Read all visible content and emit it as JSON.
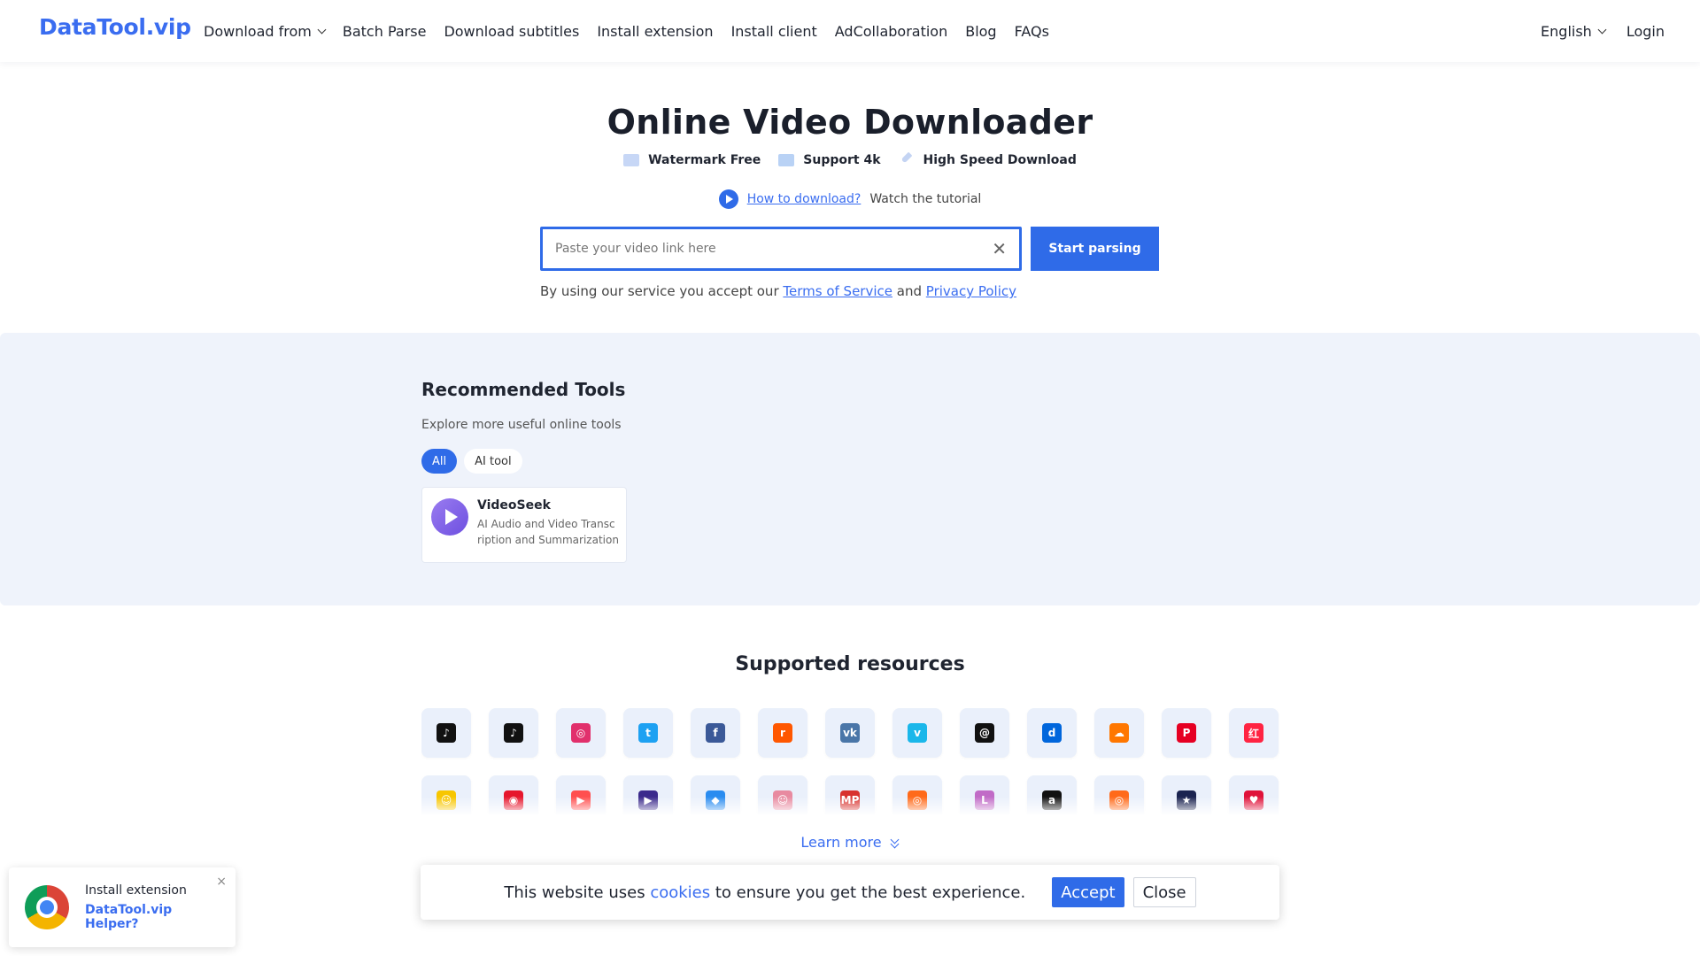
{
  "header": {
    "logo": "DataTool.vip",
    "nav": [
      {
        "label": "Download from",
        "dropdown": true
      },
      {
        "label": "Batch Parse"
      },
      {
        "label": "Download subtitles"
      },
      {
        "label": "Install extension"
      },
      {
        "label": "Install client"
      },
      {
        "label": "AdCollaboration"
      },
      {
        "label": "Blog"
      },
      {
        "label": "FAQs"
      }
    ],
    "language": "English",
    "login": "Login"
  },
  "hero": {
    "title": "Online Video Downloader",
    "features": [
      "Watermark Free",
      "Support 4k",
      "High Speed Download"
    ],
    "tutorial_link": "How to download?",
    "tutorial_text": "Watch the tutorial",
    "search_placeholder": "Paste your video link here",
    "search_value": "",
    "start_button": "Start parsing",
    "terms_prefix": "By using our service you accept our",
    "terms_link": "Terms of Service",
    "terms_and": "and",
    "privacy_link": "Privacy Policy"
  },
  "tools": {
    "title": "Recommended Tools",
    "subtitle": "Explore more useful online tools",
    "tabs": [
      {
        "label": "All",
        "active": true
      },
      {
        "label": "AI tool",
        "active": false
      }
    ],
    "cards": [
      {
        "name": "VideoSeek",
        "description": "AI Audio and Video Transcription and Summarization",
        "icon": "videoseek-play-icon"
      }
    ]
  },
  "resources": {
    "title": "Supported resources",
    "learn_more": "Learn more",
    "sites": [
      {
        "icon": "tiktok-icon",
        "glyph": "♪",
        "color": "#111111"
      },
      {
        "icon": "douyin-icon",
        "glyph": "♪",
        "color": "#111111"
      },
      {
        "icon": "instagram-icon",
        "glyph": "◎",
        "color": "#e1306c"
      },
      {
        "icon": "twitter-icon",
        "glyph": "t",
        "color": "#1da1f2"
      },
      {
        "icon": "facebook-icon",
        "glyph": "f",
        "color": "#3b5998"
      },
      {
        "icon": "reddit-icon",
        "glyph": "r",
        "color": "#ff5700"
      },
      {
        "icon": "vk-icon",
        "glyph": "vk",
        "color": "#4a76a8"
      },
      {
        "icon": "vimeo-icon",
        "glyph": "v",
        "color": "#1ab7ea"
      },
      {
        "icon": "threads-icon",
        "glyph": "@",
        "color": "#111111"
      },
      {
        "icon": "dailymotion-icon",
        "glyph": "d",
        "color": "#0066dc"
      },
      {
        "icon": "soundcloud-icon",
        "glyph": "☁",
        "color": "#ff7700"
      },
      {
        "icon": "pinterest-icon",
        "glyph": "P",
        "color": "#e60023"
      },
      {
        "icon": "xiaohongshu-icon",
        "glyph": "红",
        "color": "#ff2442"
      },
      {
        "icon": "snapchat-icon",
        "glyph": "☺",
        "color": "#f7c600"
      },
      {
        "icon": "weibo-icon",
        "glyph": "◉",
        "color": "#e6162d"
      },
      {
        "icon": "kuaishou-play-icon",
        "glyph": "▶",
        "color": "#ff4f4f"
      },
      {
        "icon": "video-play-icon",
        "glyph": "▶",
        "color": "#3b2a8c"
      },
      {
        "icon": "tencent-video-icon",
        "glyph": "◆",
        "color": "#2a8cf0"
      },
      {
        "icon": "cartoon-face-icon",
        "glyph": "☺",
        "color": "#e88aa0"
      },
      {
        "icon": "mp-icon",
        "glyph": "MP",
        "color": "#d8322e"
      },
      {
        "icon": "kuaishou-icon",
        "glyph": "◎",
        "color": "#ff6a1a"
      },
      {
        "icon": "lele-icon",
        "glyph": "L",
        "color": "#c16bc7"
      },
      {
        "icon": "amazon-icon",
        "glyph": "a",
        "color": "#111111"
      },
      {
        "icon": "kuaishou-alt-icon",
        "glyph": "◎",
        "color": "#ff6a1a"
      },
      {
        "icon": "star-video-icon",
        "glyph": "★",
        "color": "#1b2450"
      },
      {
        "icon": "heart-video-icon",
        "glyph": "♥",
        "color": "#e0123a"
      }
    ]
  },
  "cookie": {
    "text_before": "This website uses",
    "link": "cookies",
    "text_after": "to ensure you get the best experience.",
    "accept": "Accept",
    "close": "Close"
  },
  "extension_popup": {
    "line1": "Install extension",
    "line2": "DataTool.vip Helper?",
    "close": "×"
  },
  "colors": {
    "accent": "#2f6be8",
    "brand": "#3a6df0",
    "tools_bg": "#eff3fb"
  }
}
